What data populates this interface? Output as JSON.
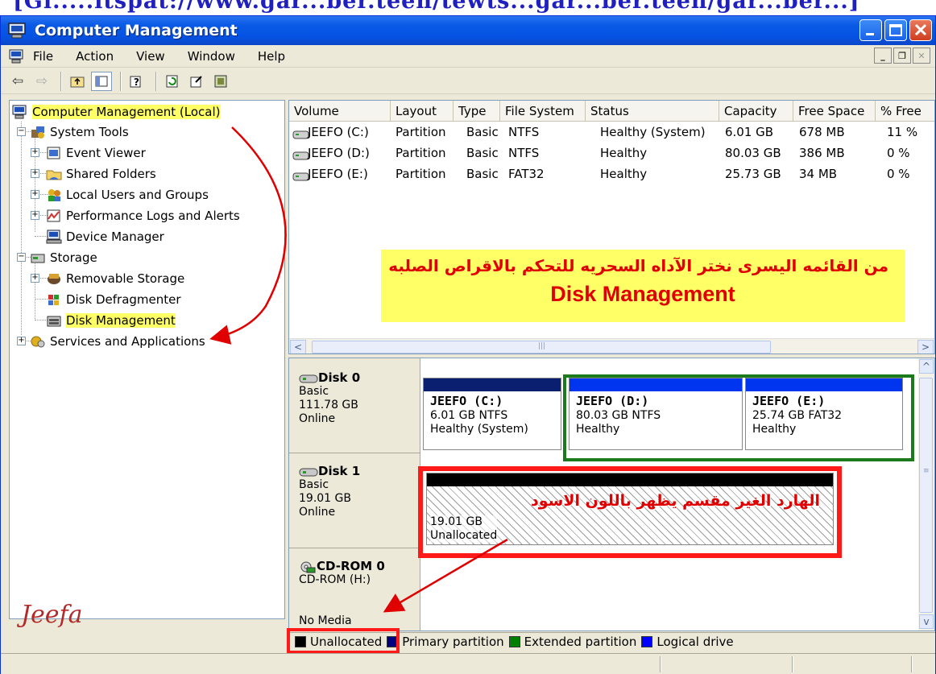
{
  "top_strip": "[Gi.....itspat://www.gar...ber.teen/tewts...gar...ber.teen/gar...ber...]",
  "window": {
    "title": "Computer Management"
  },
  "menu": [
    "File",
    "Action",
    "View",
    "Window",
    "Help"
  ],
  "tree": {
    "root": "Computer Management (Local)",
    "system_tools": "System Tools",
    "event_viewer": "Event Viewer",
    "shared_folders": "Shared Folders",
    "local_users": "Local Users and Groups",
    "perf_logs": "Performance Logs and Alerts",
    "device_manager": "Device Manager",
    "storage": "Storage",
    "removable": "Removable Storage",
    "defrag": "Disk Defragmenter",
    "disk_mgmt": "Disk Management",
    "services": "Services and Applications"
  },
  "table": {
    "headers": [
      "Volume",
      "Layout",
      "Type",
      "File System",
      "Status",
      "Capacity",
      "Free Space",
      "% Free"
    ],
    "rows": [
      [
        "JEEFO (C:)",
        "Partition",
        "Basic",
        "NTFS",
        "Healthy (System)",
        "6.01 GB",
        "678 MB",
        "11 %"
      ],
      [
        "JEEFO (D:)",
        "Partition",
        "Basic",
        "NTFS",
        "Healthy",
        "80.03 GB",
        "386 MB",
        "0 %"
      ],
      [
        "JEEFO (E:)",
        "Partition",
        "Basic",
        "FAT32",
        "Healthy",
        "25.73 GB",
        "34 MB",
        "0 %"
      ]
    ]
  },
  "annotation": {
    "arabic_top": "من القائمه اليسرى نختر الآداه السحريه للتحكم بالاقراص الصلبه",
    "english": "Disk Management",
    "arabic_unalloc": "الهارد الغير مقسم يظهر باللون الاسود"
  },
  "disks": [
    {
      "name": "Disk 0",
      "type": "Basic",
      "size": "111.78 GB",
      "state": "Online"
    },
    {
      "name": "Disk 1",
      "type": "Basic",
      "size": "19.01 GB",
      "state": "Online"
    },
    {
      "name": "CD-ROM 0",
      "type": "CD-ROM (H:)",
      "size": "",
      "state": "No Media"
    }
  ],
  "volumes": {
    "c": {
      "name": "JEEFO (C:)",
      "size": "6.01 GB NTFS",
      "status": "Healthy (System)"
    },
    "d": {
      "name": "JEEFO (D:)",
      "size": "80.03 GB NTFS",
      "status": "Healthy"
    },
    "e": {
      "name": "JEEFO (E:)",
      "size": "25.74 GB FAT32",
      "status": "Healthy"
    },
    "unalloc": {
      "size": "19.01 GB",
      "status": "Unallocated"
    }
  },
  "legend": [
    "Unallocated",
    "Primary partition",
    "Extended partition",
    "Logical drive"
  ],
  "colors": {
    "unallocated": "#000000",
    "primary": "#000080",
    "extended": "#008000",
    "logical": "#0000ff"
  },
  "signature": "Jeefa"
}
